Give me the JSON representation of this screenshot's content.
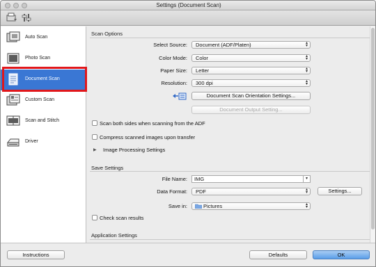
{
  "window": {
    "title": "Settings (Document Scan)"
  },
  "sidebar": {
    "items": [
      {
        "label": "Auto Scan",
        "icon": "auto-scan-icon"
      },
      {
        "label": "Photo Scan",
        "icon": "photo-scan-icon"
      },
      {
        "label": "Document Scan",
        "icon": "document-scan-icon",
        "selected": true
      },
      {
        "label": "Custom Scan",
        "icon": "custom-scan-icon"
      },
      {
        "label": "Scan and Stitch",
        "icon": "scan-stitch-icon"
      },
      {
        "label": "Driver",
        "icon": "driver-icon"
      }
    ],
    "highlight_color": "#e1171b",
    "selected_color": "#3a77d4"
  },
  "scan_options": {
    "title": "Scan Options",
    "select_source": {
      "label": "Select Source:",
      "value": "Document (ADF/Platen)"
    },
    "color_mode": {
      "label": "Color Mode:",
      "value": "Color"
    },
    "paper_size": {
      "label": "Paper Size:",
      "value": "Letter"
    },
    "resolution": {
      "label": "Resolution:",
      "value": "300 dpi"
    },
    "orientation_button": "Document Scan Orientation Settings...",
    "output_button": "Document Output Setting...",
    "scan_both_sides": "Scan both sides when scanning from the ADF",
    "compress": "Compress scanned images upon transfer",
    "image_processing": "Image Processing Settings"
  },
  "save_settings": {
    "title": "Save Settings",
    "file_name": {
      "label": "File Name:",
      "value": "IMG"
    },
    "data_format": {
      "label": "Data Format:",
      "value": "PDF"
    },
    "settings_button": "Settings...",
    "save_in": {
      "label": "Save in:",
      "value": "Pictures"
    },
    "check_scan_results": "Check scan results"
  },
  "application_settings": {
    "title": "Application Settings"
  },
  "footer": {
    "instructions": "Instructions",
    "defaults": "Defaults",
    "ok": "OK"
  }
}
